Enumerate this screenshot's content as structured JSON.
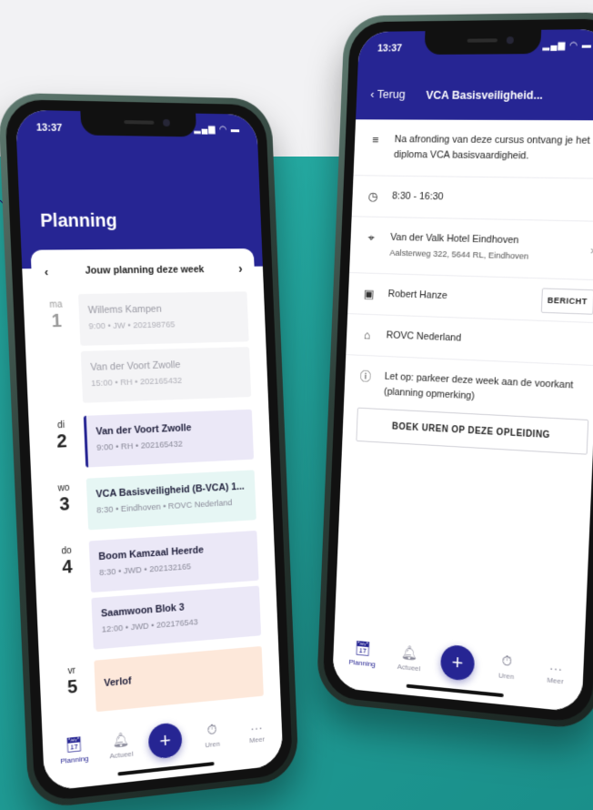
{
  "colors": {
    "brand": "#262593",
    "accent_bg": "#27b3aa"
  },
  "planning_screen": {
    "status_time": "13:37",
    "status_icons": "▂▄▆ ◠ ▬",
    "title": "Planning",
    "week_nav": {
      "prev": "‹",
      "label": "Jouw planning deze week",
      "next": "›"
    },
    "days": [
      {
        "name": "ma",
        "number": "1",
        "muted": true,
        "events": [
          {
            "title": "Willems Kampen",
            "meta": "9:00 • JW • 202198765",
            "kind": "past"
          },
          {
            "title": "Van der Voort Zwolle",
            "meta": "15:00 • RH • 202165432",
            "kind": "past"
          }
        ]
      },
      {
        "name": "di",
        "number": "2",
        "muted": false,
        "events": [
          {
            "title": "Van der Voort Zwolle",
            "meta": "9:00 • RH • 202165432",
            "kind": "current"
          }
        ]
      },
      {
        "name": "wo",
        "number": "3",
        "muted": false,
        "events": [
          {
            "title": "VCA Basisveiligheid (B-VCA) 1...",
            "meta": "8:30 • Eindhoven • ROVC Nederland",
            "kind": "course"
          }
        ]
      },
      {
        "name": "do",
        "number": "4",
        "muted": false,
        "events": [
          {
            "title": "Boom Kamzaal Heerde",
            "meta": "8:30 • JWD • 202132165",
            "kind": "normal"
          },
          {
            "title": "Saamwoon Blok 3",
            "meta": "12:00 • JWD • 202176543",
            "kind": "normal"
          }
        ]
      },
      {
        "name": "vr",
        "number": "5",
        "muted": false,
        "events": [
          {
            "title": "Verlof",
            "meta": "",
            "kind": "leave"
          }
        ]
      }
    ],
    "tabs": [
      {
        "label": "Planning",
        "icon": "calendar-icon",
        "active": true
      },
      {
        "label": "Actueel",
        "icon": "bell-icon",
        "active": false
      },
      {
        "label": "Uren",
        "icon": "stopwatch-icon",
        "active": false
      },
      {
        "label": "Meer",
        "icon": "more-icon",
        "active": false
      }
    ],
    "fab_label": "+"
  },
  "detail_screen": {
    "status_time": "13:37",
    "status_icons": "▂▄▆ ◠ ▬",
    "back_label": "Terug",
    "title": "VCA Basisveiligheid...",
    "description": "Na afronding van deze cursus ontvang je het diploma VCA basisvaardigheid.",
    "time": "8:30 - 16:30",
    "location_name": "Van der Valk Hotel Eindhoven",
    "location_address": "Aalsterweg 322, 5644 RL, Eindhoven",
    "contact_name": "Robert Hanze",
    "message_button": "BERICHT",
    "organization": "ROVC Nederland",
    "note": "Let op: parkeer deze week aan de voorkant (planning opmerking)",
    "book_button": "BOEK UREN OP DEZE OPLEIDING",
    "tabs": [
      {
        "label": "Planning",
        "icon": "calendar-icon",
        "active": true
      },
      {
        "label": "Actueel",
        "icon": "bell-icon",
        "active": false
      },
      {
        "label": "Uren",
        "icon": "stopwatch-icon",
        "active": false
      },
      {
        "label": "Meer",
        "icon": "more-icon",
        "active": false
      }
    ],
    "fab_label": "+"
  }
}
